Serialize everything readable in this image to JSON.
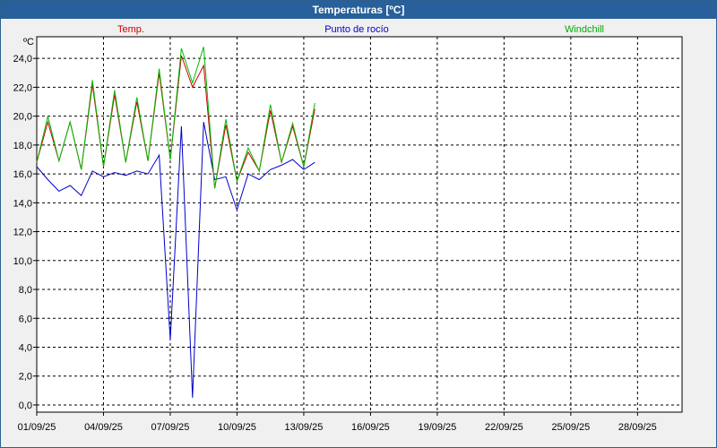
{
  "window": {
    "title": "Temperaturas [ºC]"
  },
  "chart_data": {
    "type": "line",
    "title": "Temperaturas [ºC]",
    "ylabel": "ºC",
    "ylim": [
      -0.5,
      25.5
    ],
    "xlim": [
      "2025-09-01",
      "2025-09-30"
    ],
    "grid": true,
    "legend_placement": "top",
    "y_ticks": [
      "0,0",
      "2,0",
      "4,0",
      "6,0",
      "8,0",
      "10,0",
      "12,0",
      "14,0",
      "16,0",
      "18,0",
      "20,0",
      "22,0",
      "24,0"
    ],
    "x_ticks": [
      "01/09/25",
      "04/09/25",
      "07/09/25",
      "10/09/25",
      "13/09/25",
      "16/09/25",
      "19/09/25",
      "22/09/25",
      "25/09/25",
      "28/09/25"
    ],
    "series": [
      {
        "name": "Temp.",
        "color": "#cc0000",
        "x": [
          "2025-09-01",
          "2025-09-01 12h",
          "2025-09-02",
          "2025-09-02 12h",
          "2025-09-03",
          "2025-09-03 12h",
          "2025-09-04",
          "2025-09-04 12h",
          "2025-09-05",
          "2025-09-05 12h",
          "2025-09-06",
          "2025-09-06 12h",
          "2025-09-07",
          "2025-09-07 12h",
          "2025-09-08",
          "2025-09-08 12h",
          "2025-09-09",
          "2025-09-09 12h",
          "2025-09-10",
          "2025-09-10 12h",
          "2025-09-11",
          "2025-09-11 12h",
          "2025-09-12",
          "2025-09-12 12h",
          "2025-09-13",
          "2025-09-13 12h"
        ],
        "values": [
          16.8,
          19.6,
          16.9,
          19.6,
          16.3,
          22.2,
          16.5,
          21.5,
          16.8,
          21.0,
          16.9,
          23.0,
          17.0,
          24.2,
          22.0,
          23.5,
          15.0,
          19.4,
          15.5,
          17.5,
          16.2,
          20.4,
          16.8,
          19.3,
          16.5,
          20.5
        ]
      },
      {
        "name": "Punto de rocío",
        "color": "#0000cc",
        "x": [
          "2025-09-01",
          "2025-09-01 12h",
          "2025-09-02",
          "2025-09-02 12h",
          "2025-09-03",
          "2025-09-03 12h",
          "2025-09-04",
          "2025-09-04 12h",
          "2025-09-05",
          "2025-09-05 12h",
          "2025-09-06",
          "2025-09-06 12h",
          "2025-09-07",
          "2025-09-07 12h",
          "2025-09-08",
          "2025-09-08 12h",
          "2025-09-09",
          "2025-09-09 12h",
          "2025-09-10",
          "2025-09-10 12h",
          "2025-09-11",
          "2025-09-11 12h",
          "2025-09-12",
          "2025-09-12 12h",
          "2025-09-13",
          "2025-09-13 12h"
        ],
        "values": [
          16.5,
          15.6,
          14.8,
          15.2,
          14.5,
          16.2,
          15.8,
          16.1,
          15.9,
          16.2,
          16.0,
          17.3,
          4.5,
          19.3,
          0.5,
          19.6,
          15.6,
          15.8,
          13.5,
          16.0,
          15.6,
          16.3,
          16.6,
          17.0,
          16.3,
          16.8
        ]
      },
      {
        "name": "Windchill",
        "color": "#00bb00",
        "x": [
          "2025-09-01",
          "2025-09-01 12h",
          "2025-09-02",
          "2025-09-02 12h",
          "2025-09-03",
          "2025-09-03 12h",
          "2025-09-04",
          "2025-09-04 12h",
          "2025-09-05",
          "2025-09-05 12h",
          "2025-09-06",
          "2025-09-06 12h",
          "2025-09-07",
          "2025-09-07 12h",
          "2025-09-08",
          "2025-09-08 12h",
          "2025-09-09",
          "2025-09-09 12h",
          "2025-09-10",
          "2025-09-10 12h",
          "2025-09-11",
          "2025-09-11 12h",
          "2025-09-12",
          "2025-09-12 12h",
          "2025-09-13",
          "2025-09-13 12h"
        ],
        "values": [
          16.8,
          20.0,
          16.9,
          19.6,
          16.3,
          22.5,
          16.5,
          21.8,
          16.8,
          21.3,
          16.9,
          23.3,
          17.0,
          24.7,
          22.3,
          24.8,
          15.0,
          19.8,
          15.5,
          17.8,
          16.2,
          20.8,
          16.8,
          19.5,
          16.5,
          20.9
        ]
      }
    ]
  }
}
